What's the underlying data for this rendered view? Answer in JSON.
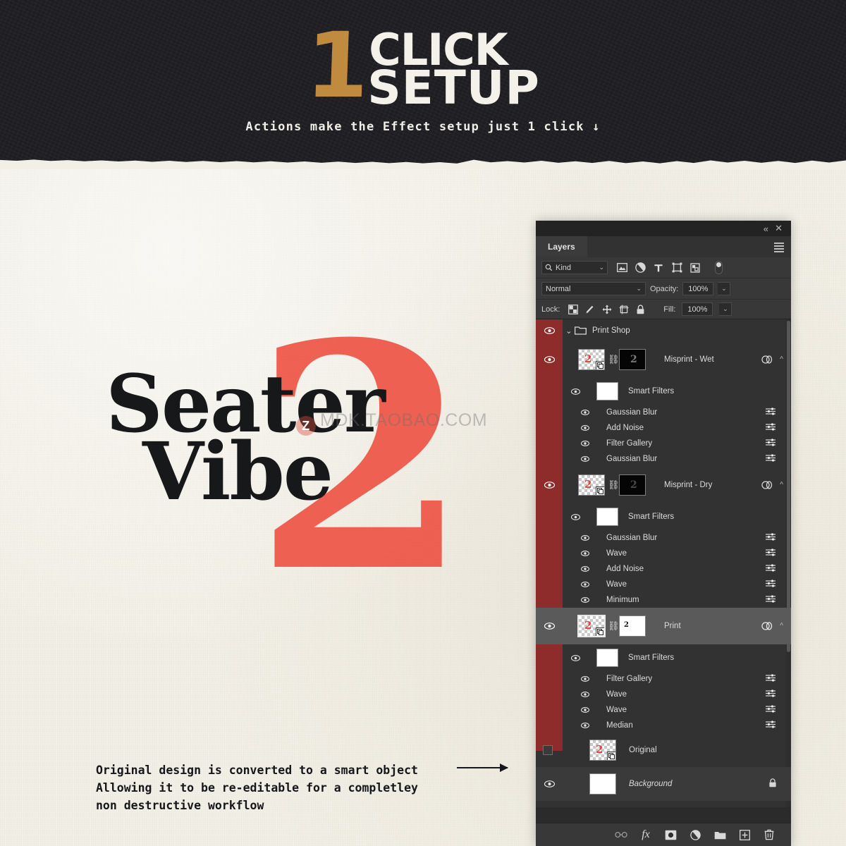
{
  "banner": {
    "number": "1",
    "word1": "CLICK",
    "word2": "SETUP",
    "tagline": "Actions make the Effect setup just 1 click ↓"
  },
  "artwork": {
    "number": "2",
    "line1": "Seater",
    "line2": "Vibe",
    "watermark": "MDK.TAOBAO.COM",
    "watermark_badge": "Z"
  },
  "caption": {
    "line1": "Original design is converted to a smart object",
    "line2": "Allowing it to be re-editable for a completley",
    "line3": "non destructive workflow"
  },
  "panel": {
    "tab_label": "Layers",
    "collapse_icon": "«",
    "close_icon": "✕",
    "menu_icon": "hamburger-menu-icon",
    "filter": {
      "kind_label": "Kind",
      "search_icon": "search-icon",
      "chevron": "⌄",
      "icons": [
        "pixel-layer-icon",
        "adjustment-layer-icon",
        "type-layer-icon",
        "shape-layer-icon",
        "smart-object-icon"
      ],
      "toggle": "filter-toggle"
    },
    "blend": {
      "mode": "Normal",
      "chevron": "⌄",
      "opacity_label": "Opacity:",
      "opacity_value": "100%"
    },
    "lock": {
      "label": "Lock:",
      "icons": [
        "lock-transparent-pixels-icon",
        "lock-image-pixels-icon",
        "lock-position-icon",
        "lock-artboard-icon",
        "lock-all-icon"
      ],
      "fill_label": "Fill:",
      "fill_value": "100%"
    },
    "rows": [
      {
        "type": "group",
        "name": "Print Shop",
        "visible": true
      },
      {
        "type": "layer",
        "name": "Misprint - Wet",
        "visible": true,
        "selected": false,
        "has_mask": true,
        "mask": "black"
      },
      {
        "type": "sf",
        "name": "Smart Filters",
        "visible": true
      },
      {
        "type": "filter",
        "name": "Gaussian Blur",
        "visible": true
      },
      {
        "type": "filter",
        "name": "Add Noise",
        "visible": true
      },
      {
        "type": "filter",
        "name": "Filter Gallery",
        "visible": true
      },
      {
        "type": "filter",
        "name": "Gaussian Blur",
        "visible": true
      },
      {
        "type": "layer",
        "name": "Misprint - Dry",
        "visible": true,
        "selected": false,
        "has_mask": true,
        "mask": "black"
      },
      {
        "type": "sf",
        "name": "Smart Filters",
        "visible": true
      },
      {
        "type": "filter",
        "name": "Gaussian Blur",
        "visible": true
      },
      {
        "type": "filter",
        "name": "Wave",
        "visible": true
      },
      {
        "type": "filter",
        "name": "Add Noise",
        "visible": true
      },
      {
        "type": "filter",
        "name": "Wave",
        "visible": true
      },
      {
        "type": "filter",
        "name": "Minimum",
        "visible": true
      },
      {
        "type": "layer",
        "name": "Print",
        "visible": true,
        "selected": true,
        "has_mask": true,
        "mask": "white"
      },
      {
        "type": "sf",
        "name": "Smart Filters",
        "visible": true
      },
      {
        "type": "filter",
        "name": "Filter Gallery",
        "visible": true
      },
      {
        "type": "filter",
        "name": "Wave",
        "visible": true
      },
      {
        "type": "filter",
        "name": "Wave",
        "visible": true
      },
      {
        "type": "filter",
        "name": "Median",
        "visible": true
      },
      {
        "type": "plain",
        "name": "Original",
        "visible": false
      },
      {
        "type": "plain",
        "name": "Background",
        "visible": true,
        "locked": true,
        "italic": true
      }
    ],
    "footer_icons": [
      "link-layers-icon",
      "layer-style-fx-icon",
      "add-mask-icon",
      "adjustment-layer-icon",
      "new-group-icon",
      "new-layer-icon",
      "delete-layer-icon"
    ]
  },
  "colors": {
    "paper": "#f2efe6",
    "banner": "#1d1d22",
    "accent_gold": "#c08b3e",
    "accent_red": "#ee5546",
    "panel_bg": "#323232",
    "eye_strip_red": "#8e2b2b"
  }
}
